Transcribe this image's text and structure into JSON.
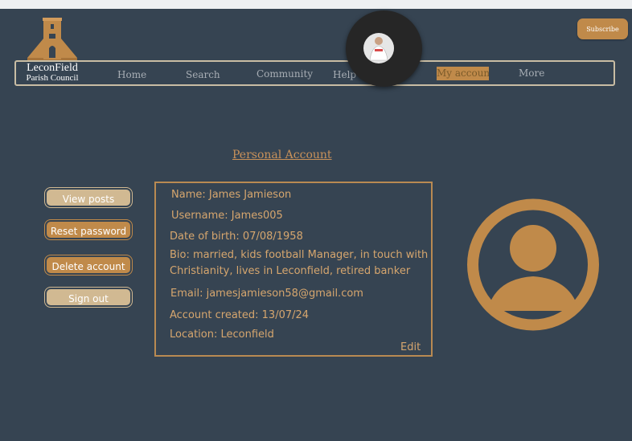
{
  "header": {
    "logo": {
      "line1": "LeconField",
      "line2": "Parish Council"
    },
    "nav": [
      {
        "label": "Home"
      },
      {
        "label": "Search"
      },
      {
        "label": "Community"
      },
      {
        "label": "Help"
      },
      {
        "label": "My account"
      },
      {
        "label": "More"
      }
    ],
    "subscribe_label": "Subscribe"
  },
  "page": {
    "title": "Personal Account"
  },
  "sidebar": {
    "buttons": [
      {
        "label": "View posts"
      },
      {
        "label": "Reset password"
      },
      {
        "label": "Delete account"
      },
      {
        "label": "Sign out"
      }
    ]
  },
  "profile": {
    "name": "Name: James Jamieson",
    "username": "Username: James005",
    "dob": "Date of birth: 07/08/1958",
    "bio_line1": "Bio: married, kids football Manager, in touch with",
    "bio_line2": "Christianity, lives in Leconfield, retired banker",
    "email": "Email: jamesjamieson58@gmail.com",
    "created": "Account created: 13/07/24",
    "location": "Location: Leconfield",
    "edit_label": "Edit"
  },
  "colors": {
    "background": "#364452",
    "accent": "#c08a4a",
    "button_light": "#d1b992"
  },
  "icons": [
    "church-logo-icon",
    "music-record-icon",
    "user-avatar-icon"
  ]
}
